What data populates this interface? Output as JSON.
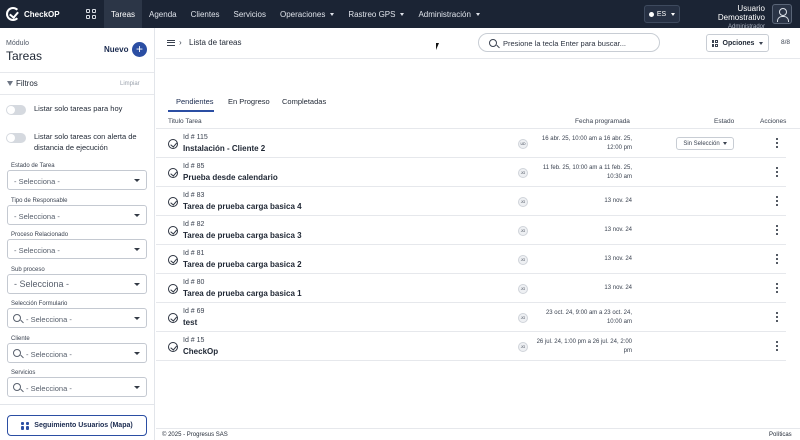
{
  "brand": {
    "name": "CheckOP"
  },
  "nav": {
    "items": [
      {
        "label": "Tareas",
        "active": true,
        "has_caret": false
      },
      {
        "label": "Agenda",
        "active": false,
        "has_caret": false
      },
      {
        "label": "Clientes",
        "active": false,
        "has_caret": false
      },
      {
        "label": "Servicios",
        "active": false,
        "has_caret": false
      },
      {
        "label": "Operaciones",
        "active": false,
        "has_caret": true
      },
      {
        "label": "Rastreo GPS",
        "active": false,
        "has_caret": true
      },
      {
        "label": "Administración",
        "active": false,
        "has_caret": true
      }
    ],
    "language": "ES"
  },
  "user": {
    "name": "Usuario Demostrativo",
    "role": "Administrador"
  },
  "sidebar": {
    "module_label": "Módulo",
    "module_title": "Tareas",
    "new_label": "Nuevo",
    "new_symbol": "+",
    "filters_title": "Filtros",
    "clear_label": "Limpiar",
    "toggles": [
      {
        "label": "Listar solo tareas para hoy",
        "on": false
      },
      {
        "label": "Listar solo tareas con alerta de distancia de ejecución",
        "on": false
      }
    ],
    "selects": [
      {
        "label": "Estado de Tarea",
        "value": "- Selecciona -",
        "searchable": false,
        "big": false
      },
      {
        "label": "Tipo de Responsable",
        "value": "- Selecciona -",
        "searchable": false,
        "big": false
      },
      {
        "label": "Proceso Relacionado",
        "value": "- Selecciona -",
        "searchable": false,
        "big": false
      },
      {
        "label": "Sub proceso",
        "value": "- Selecciona -",
        "searchable": false,
        "big": true
      },
      {
        "label": "Selección Formulario",
        "value": "- Selecciona -",
        "searchable": true,
        "big": false
      },
      {
        "label": "Cliente",
        "value": "- Selecciona -",
        "searchable": true,
        "big": false
      },
      {
        "label": "Servicios",
        "value": "- Selecciona -",
        "searchable": true,
        "big": false
      }
    ],
    "tracking_button": "Seguimiento Usuarios (Mapa)"
  },
  "topbar": {
    "breadcrumb_sep": "›",
    "breadcrumb": "Lista de tareas",
    "search_placeholder": "Presione la tecla Enter para buscar...",
    "options_label": "Opciones",
    "count": "8/8"
  },
  "tabs": [
    {
      "label": "Pendientes",
      "active": true
    },
    {
      "label": "En Progreso",
      "active": false
    },
    {
      "label": "Completadas",
      "active": false
    }
  ],
  "table": {
    "headers": {
      "title": "Titulo Tarea",
      "date": "Fecha programada",
      "status": "Estado",
      "actions": "Acciones"
    },
    "rows": [
      {
        "id": "Id # 115",
        "name": "Instalación - Cliente 2",
        "initials": "UD",
        "date_line1": "16 abr. 25, 10:00 am a 16 abr. 25,",
        "date_line2": "12:00 pm",
        "status": "Sin Selección"
      },
      {
        "id": "Id # 85",
        "name": "Prueba desde calendario",
        "initials": "JG",
        "date_line1": "11 feb. 25, 10:00 am a 11 feb. 25,",
        "date_line2": "10:30 am",
        "status": ""
      },
      {
        "id": "Id # 83",
        "name": "Tarea de prueba carga basica 4",
        "initials": "JG",
        "date_line1": "13 nov. 24",
        "date_line2": "",
        "status": ""
      },
      {
        "id": "Id # 82",
        "name": "Tarea de prueba carga basica 3",
        "initials": "JG",
        "date_line1": "13 nov. 24",
        "date_line2": "",
        "status": ""
      },
      {
        "id": "Id # 81",
        "name": "Tarea de prueba carga basica 2",
        "initials": "JG",
        "date_line1": "13 nov. 24",
        "date_line2": "",
        "status": ""
      },
      {
        "id": "Id # 80",
        "name": "Tarea de prueba carga basica 1",
        "initials": "JG",
        "date_line1": "13 nov. 24",
        "date_line2": "",
        "status": ""
      },
      {
        "id": "Id # 69",
        "name": "test",
        "initials": "JG",
        "date_line1": "23 oct. 24, 9:00 am a 23 oct. 24,",
        "date_line2": "10:00 am",
        "status": ""
      },
      {
        "id": "Id # 15",
        "name": "CheckOp",
        "initials": "JG",
        "date_line1": "26 jul. 24, 1:00 pm a 26 jul. 24, 2:00",
        "date_line2": "pm",
        "status": ""
      }
    ]
  },
  "footer": {
    "copyright": "© 2025 - Progresus SAS",
    "policies": "Políticas"
  },
  "colors": {
    "navbar": "#1b2434",
    "primary": "#2b4ea3",
    "border": "#e6e8ec"
  }
}
